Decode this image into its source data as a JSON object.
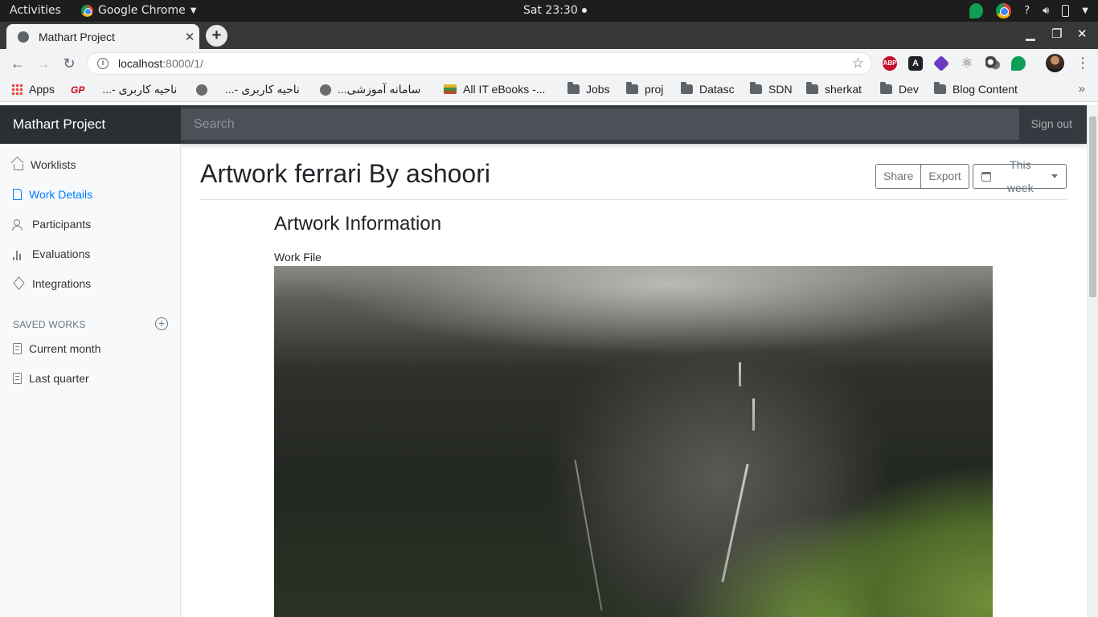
{
  "os_bar": {
    "activities": "Activities",
    "app_name": "Google Chrome",
    "clock": "Sat 23:30",
    "help": "?"
  },
  "browser": {
    "tab_title": "Mathart Project",
    "url_host": "localhost",
    "url_path": ":8000/1/",
    "bookmarks": [
      {
        "label": "Apps",
        "icon": "apps-grid-icon"
      },
      {
        "label": "ناحیه کاربری -...",
        "icon": "gp-logo-icon"
      },
      {
        "label": "ناحیه کاربری -...",
        "icon": "globe-icon"
      },
      {
        "label": "سامانه آموزشی...",
        "icon": "globe-icon"
      },
      {
        "label": "All IT eBooks -...",
        "icon": "books-icon"
      },
      {
        "label": "Jobs",
        "icon": "folder-icon"
      },
      {
        "label": "proj",
        "icon": "folder-icon"
      },
      {
        "label": "Datasc",
        "icon": "folder-icon"
      },
      {
        "label": "SDN",
        "icon": "folder-icon"
      },
      {
        "label": "sherkat",
        "icon": "folder-icon"
      },
      {
        "label": "Dev",
        "icon": "folder-icon"
      },
      {
        "label": "Blog Content",
        "icon": "folder-icon"
      }
    ],
    "extensions": {
      "abp": "ABP",
      "a": "A"
    }
  },
  "app": {
    "brand": "Mathart Project",
    "search_placeholder": "Search",
    "sign_out": "Sign out",
    "accent_color": "#007bff"
  },
  "sidebar": {
    "items": [
      {
        "label": "Worklists",
        "icon": "home-icon",
        "active": false
      },
      {
        "label": "Work Details",
        "icon": "file-icon",
        "active": true
      },
      {
        "label": "Participants",
        "icon": "users-icon",
        "active": false
      },
      {
        "label": "Evaluations",
        "icon": "bar-chart-icon",
        "active": false
      },
      {
        "label": "Integrations",
        "icon": "layers-icon",
        "active": false
      }
    ],
    "saved_heading": "SAVED WORKS",
    "saved_items": [
      {
        "label": "Current month",
        "icon": "file-text-icon"
      },
      {
        "label": "Last quarter",
        "icon": "file-text-icon"
      }
    ]
  },
  "main": {
    "title": "Artwork ferrari By ashoori",
    "share": "Share",
    "export": "Export",
    "period": "This week",
    "section_title": "Artwork Information",
    "work_file_label": "Work File",
    "image_description": "landscape-photo-mountain-waterfall"
  }
}
